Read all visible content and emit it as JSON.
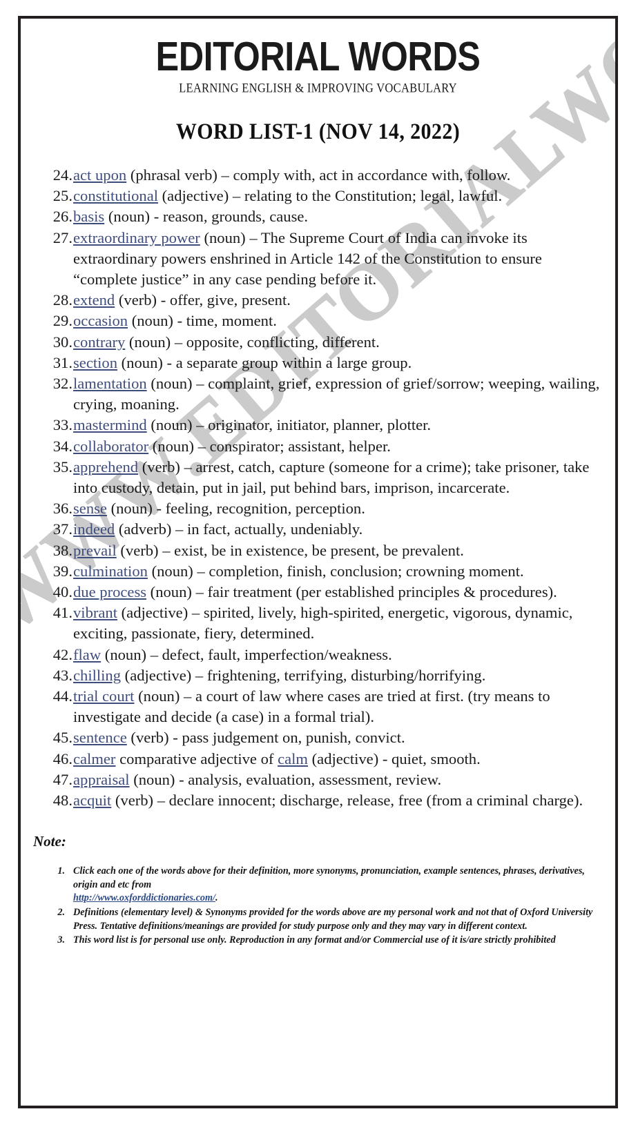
{
  "masthead": {
    "brand": "EDITORIAL WORDS",
    "tagline": "LEARNING ENGLISH & IMPROVING VOCABULARY"
  },
  "list_title": "WORD LIST-1 (NOV 14, 2022)",
  "watermark": {
    "text": "WWW.EDITORIALWORDS.COM",
    "color": "#bfbfbf"
  },
  "link_color": "#3f4d7c",
  "entries": [
    {
      "num": "24.",
      "word": "act upon",
      "rest": " (phrasal verb) – comply with, act in accordance with, follow."
    },
    {
      "num": "25.",
      "word": "constitutional",
      "rest": " (adjective) – relating to the Constitution; legal, lawful."
    },
    {
      "num": "26.",
      "word": "basis",
      "rest": " (noun) - reason, grounds, cause."
    },
    {
      "num": "27.",
      "word": "extraordinary power",
      "rest": " (noun) – The Supreme Court of India can invoke its extraordinary powers enshrined in Article 142 of the Constitution to ensure “complete justice” in any case pending before it."
    },
    {
      "num": "28.",
      "word": "extend",
      "rest": " (verb) - offer, give, present."
    },
    {
      "num": "29.",
      "word": "occasion",
      "rest": " (noun) - time, moment."
    },
    {
      "num": "30.",
      "word": "contrary",
      "rest": " (noun) – opposite, conflicting, different."
    },
    {
      "num": "31.",
      "word": "section",
      "rest": " (noun) - a separate group within a large group."
    },
    {
      "num": "32.",
      "word": "lamentation",
      "rest": " (noun) – complaint, grief, expression of grief/sorrow; weeping, wailing, crying, moaning."
    },
    {
      "num": "33.",
      "word": "mastermind",
      "rest": " (noun) – originator, initiator, planner, plotter."
    },
    {
      "num": "34.",
      "word": "collaborator",
      "rest": " (noun) – conspirator; assistant, helper."
    },
    {
      "num": "35.",
      "word": "apprehend",
      "rest": " (verb) – arrest, catch, capture (someone for a crime); take prisoner, take into custody, detain, put in jail, put behind bars, imprison, incarcerate."
    },
    {
      "num": "36.",
      "word": "sense",
      "rest": " (noun) - feeling, recognition, perception."
    },
    {
      "num": "37.",
      "word": "indeed",
      "rest": " (adverb) – in fact, actually, undeniably."
    },
    {
      "num": "38.",
      "word": "prevail",
      "rest": " (verb) – exist, be in existence, be present, be prevalent."
    },
    {
      "num": "39.",
      "word": "culmination",
      "rest": " (noun) – completion, finish, conclusion; crowning moment."
    },
    {
      "num": "40.",
      "word": "due process",
      "rest": " (noun) – fair treatment (per established principles & procedures)."
    },
    {
      "num": "41.",
      "word": "vibrant",
      "rest": " (adjective) – spirited, lively, high-spirited, energetic, vigorous, dynamic, exciting, passionate, fiery, determined."
    },
    {
      "num": "42.",
      "word": "flaw",
      "rest": " (noun) – defect, fault, imperfection/weakness."
    },
    {
      "num": "43.",
      "word": "chilling",
      "rest": " (adjective) – frightening, terrifying, disturbing/horrifying."
    },
    {
      "num": "44.",
      "word": "trial court",
      "rest": " (noun) – a court of law where cases are tried at first. (try means to investigate and decide (a case) in a formal trial)."
    },
    {
      "num": "45.",
      "word": "sentence",
      "rest": " (verb) - pass judgement on, punish, convict."
    },
    {
      "num": "46.",
      "word": "calmer",
      "mid": " comparative adjective of ",
      "word2": "calm",
      "rest": " (adjective) - quiet, smooth."
    },
    {
      "num": "47.",
      "word": "appraisal",
      "rest": " (noun) - analysis, evaluation, assessment, review."
    },
    {
      "num": "48.",
      "word": "acquit",
      "rest": " (verb) – declare innocent; discharge, release, free (from a criminal charge)."
    }
  ],
  "note": {
    "heading": "Note:",
    "items": [
      {
        "num": "1.",
        "text_before": "Click each one of the words above for their definition, more synonyms, pronunciation, example sentences, phrases, derivatives, origin and etc from ",
        "link": "http://www.oxforddictionaries.com/",
        "text_after": "."
      },
      {
        "num": "2.",
        "text_before": "Definitions (elementary level) & Synonyms provided for the words above are my personal work and not that of Oxford University Press. Tentative definitions/meanings are provided for study purpose only and they may vary in different context.",
        "link": "",
        "text_after": ""
      },
      {
        "num": "3.",
        "text_before": "This word list is for personal use only. Reproduction in any format and/or Commercial use of it is/are strictly prohibited",
        "link": "",
        "text_after": ""
      }
    ]
  }
}
